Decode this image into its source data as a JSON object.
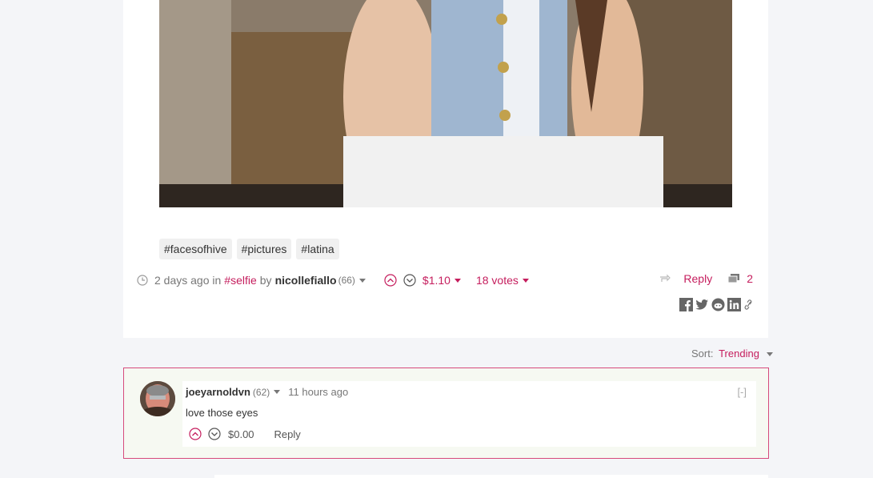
{
  "post": {
    "tags": [
      "#facesofhive",
      "#pictures",
      "#latina"
    ],
    "time_ago": "2 days ago in",
    "community": "#selfie",
    "by_label": "by",
    "author": "nicollefiallo",
    "reputation": "(66)",
    "payout": "$1.10",
    "votes": "18 votes",
    "reply_label": "Reply",
    "comment_count": "2"
  },
  "sort": {
    "label": "Sort:",
    "value": "Trending"
  },
  "comment": {
    "author": "joeyarnoldvn",
    "reputation": "(62)",
    "time_ago": "11 hours ago",
    "collapse": "[-]",
    "body": "love those eyes",
    "payout": "$0.00",
    "reply_label": "Reply"
  },
  "colors": {
    "accent": "#c51d5d",
    "comment_border": "#d64a7c"
  },
  "icons": [
    "clock-icon",
    "upvote-icon",
    "downvote-icon",
    "reblog-icon",
    "comments-icon",
    "facebook-icon",
    "twitter-icon",
    "reddit-icon",
    "linkedin-icon",
    "link-icon"
  ]
}
